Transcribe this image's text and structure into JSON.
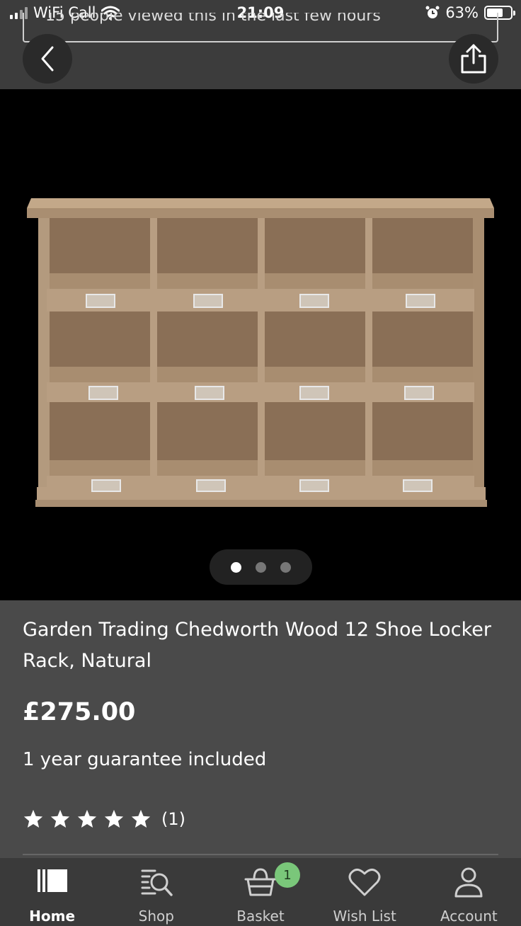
{
  "status_bar": {
    "carrier": "WiFi Call",
    "time": "21:09",
    "battery": "63%",
    "battery_level": 0.63
  },
  "header": {
    "views_notice": "15 people viewed this in the last few hours",
    "back_icon": "chevron-left-icon",
    "share_icon": "share-icon"
  },
  "gallery": {
    "image_count": 3,
    "active_index": 0,
    "image_subject": "wooden shoe locker rack with 12 cubbies"
  },
  "product": {
    "title": "Garden Trading Chedworth Wood 12 Shoe Locker Rack, Natural",
    "price": "£275.00",
    "guarantee": "1 year guarantee included",
    "rating_stars": 5,
    "review_count": "(1)"
  },
  "tabbar": {
    "tabs": [
      {
        "label": "Home",
        "icon": "home-icon"
      },
      {
        "label": "Shop",
        "icon": "shop-search-icon"
      },
      {
        "label": "Basket",
        "icon": "basket-icon"
      },
      {
        "label": "Wish List",
        "icon": "heart-icon"
      },
      {
        "label": "Account",
        "icon": "person-icon"
      }
    ],
    "active": "Home",
    "basket_badge": "1"
  },
  "colors": {
    "header_bg": "#3c3c3c",
    "details_bg": "#4a4a4a",
    "tabbar_bg": "#3a3a3a",
    "badge_green": "#7ac77a",
    "wood": "#b69a7c"
  }
}
